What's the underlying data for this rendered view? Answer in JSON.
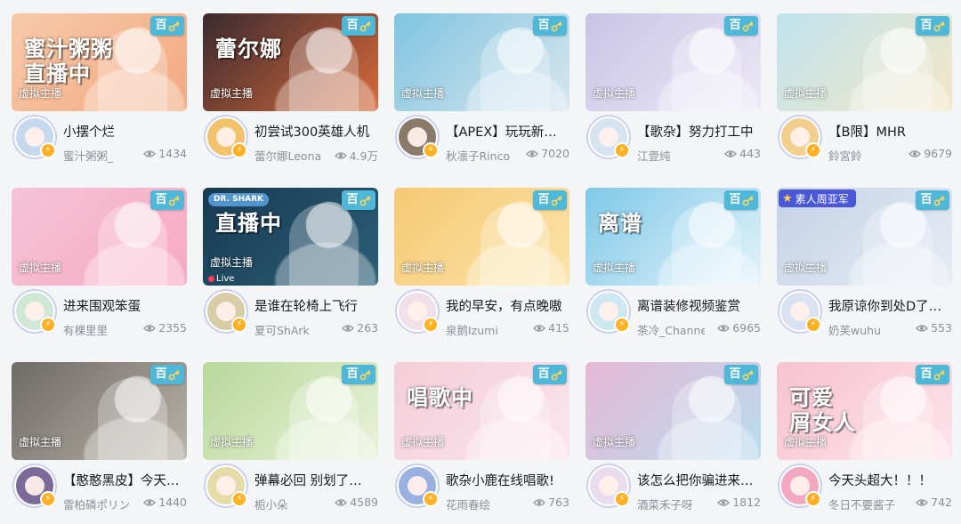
{
  "badge_text": "百",
  "cards": [
    {
      "title": "小摆个烂",
      "anchor": "蜜汁粥粥_",
      "views": "1434",
      "area": "虚拟主播",
      "headline": "蜜汁粥粥\n直播中",
      "bg": [
        "#f7c9a8",
        "#f2a982"
      ],
      "avatar_bg": "#c6d8ee"
    },
    {
      "title": "初尝试300英雄人机",
      "anchor": "蕾尔娜Leona",
      "views": "4.9万",
      "area": "虚拟主播",
      "headline": "蕾尔娜",
      "bg": [
        "#3a2a30",
        "#d86a3a"
      ],
      "avatar_bg": "#f2c36a"
    },
    {
      "title": "【APEX】玩玩新…",
      "anchor": "秋凛子Rinco",
      "views": "7020",
      "area": "虚拟主播",
      "headline": "",
      "bg": [
        "#7fc4e0",
        "#d8e6ee"
      ],
      "avatar_bg": "#8a7a6a"
    },
    {
      "title": "【歌杂】努力打工中",
      "anchor": "江壹纯",
      "views": "443",
      "area": "虚拟主播",
      "headline": "",
      "bg": [
        "#c9c4e6",
        "#ece8f6"
      ],
      "avatar_bg": "#d6e4f2"
    },
    {
      "title": "【B限】MHR",
      "anchor": "鈴宮鈴",
      "views": "9679",
      "area": "虚拟主播",
      "headline": "",
      "bg": [
        "#bfe4ee",
        "#f4e6c6"
      ],
      "avatar_bg": "#f2cf8c"
    },
    {
      "title": "进来围观笨蛋",
      "anchor": "有棵里里",
      "views": "2355",
      "area": "虚拟主播",
      "headline": "",
      "bg": [
        "#f6c3d6",
        "#f7a9c3"
      ],
      "avatar_bg": "#cfe8d6"
    },
    {
      "title": "是谁在轮椅上飞行",
      "anchor": "夏可ShArk",
      "views": "263",
      "area": "虚拟主播",
      "headline": "直播中",
      "bg": [
        "#173a52",
        "#2c5f78"
      ],
      "avatar_bg": "#d7cca6"
    },
    {
      "title": "我的早安，有点晚嗷",
      "anchor": "泉鹅Izumi",
      "views": "415",
      "area": "虚拟主播",
      "headline": "",
      "bg": [
        "#f6c874",
        "#fbe4a8"
      ],
      "avatar_bg": "#efe0ea"
    },
    {
      "title": "离谱装修视频鉴赏",
      "anchor": "茶冷_Channel",
      "views": "6965",
      "area": "虚拟主播",
      "headline": "离谱",
      "bg": [
        "#7fc8e8",
        "#e4f4fa"
      ],
      "avatar_bg": "#cde8f0"
    },
    {
      "title": "我原谅你到处D了…",
      "anchor": "奶芙wuhu",
      "views": "553",
      "area": "虚拟主播",
      "headline": "",
      "bg": [
        "#c4d2e6",
        "#e6ecf4"
      ],
      "avatar_bg": "#d9e2f2"
    },
    {
      "title": "【憨憨黑皮】今天…",
      "anchor": "雷柏磷ポリン",
      "views": "1440",
      "area": "虚拟主播",
      "headline": "",
      "bg": [
        "#6e6a66",
        "#b9b2a8"
      ],
      "avatar_bg": "#7b6a9a"
    },
    {
      "title": "弹幕必回 别划了…",
      "anchor": "栀小朵",
      "views": "4589",
      "area": "虚拟主播",
      "headline": "",
      "bg": [
        "#b7d89a",
        "#eaf2da"
      ],
      "avatar_bg": "#e6dcaa"
    },
    {
      "title": "歌杂小鹿在线唱歌!",
      "anchor": "花雨春绘",
      "views": "763",
      "area": "虚拟主播",
      "headline": "唱歌中",
      "bg": [
        "#f4cdd8",
        "#fbe6ee"
      ],
      "avatar_bg": "#9ab0e0"
    },
    {
      "title": "该怎么把你骗进来…",
      "anchor": "酒菜禾子呀",
      "views": "1812",
      "area": "虚拟主播",
      "headline": "",
      "bg": [
        "#e6b8d6",
        "#b9dcef"
      ],
      "avatar_bg": "#e9dcec"
    },
    {
      "title": "今天头超大！！！",
      "anchor": "冬日不要酱子",
      "views": "742",
      "area": "虚拟主播",
      "headline": "可爱\n屑女人",
      "bg": [
        "#f6c2d0",
        "#fde4ea"
      ],
      "avatar_bg": "#f2a8c0"
    }
  ],
  "special": {
    "top_chip": "素人周亚军",
    "brand_chip": "DR. SHARK",
    "live_text": "Live"
  }
}
